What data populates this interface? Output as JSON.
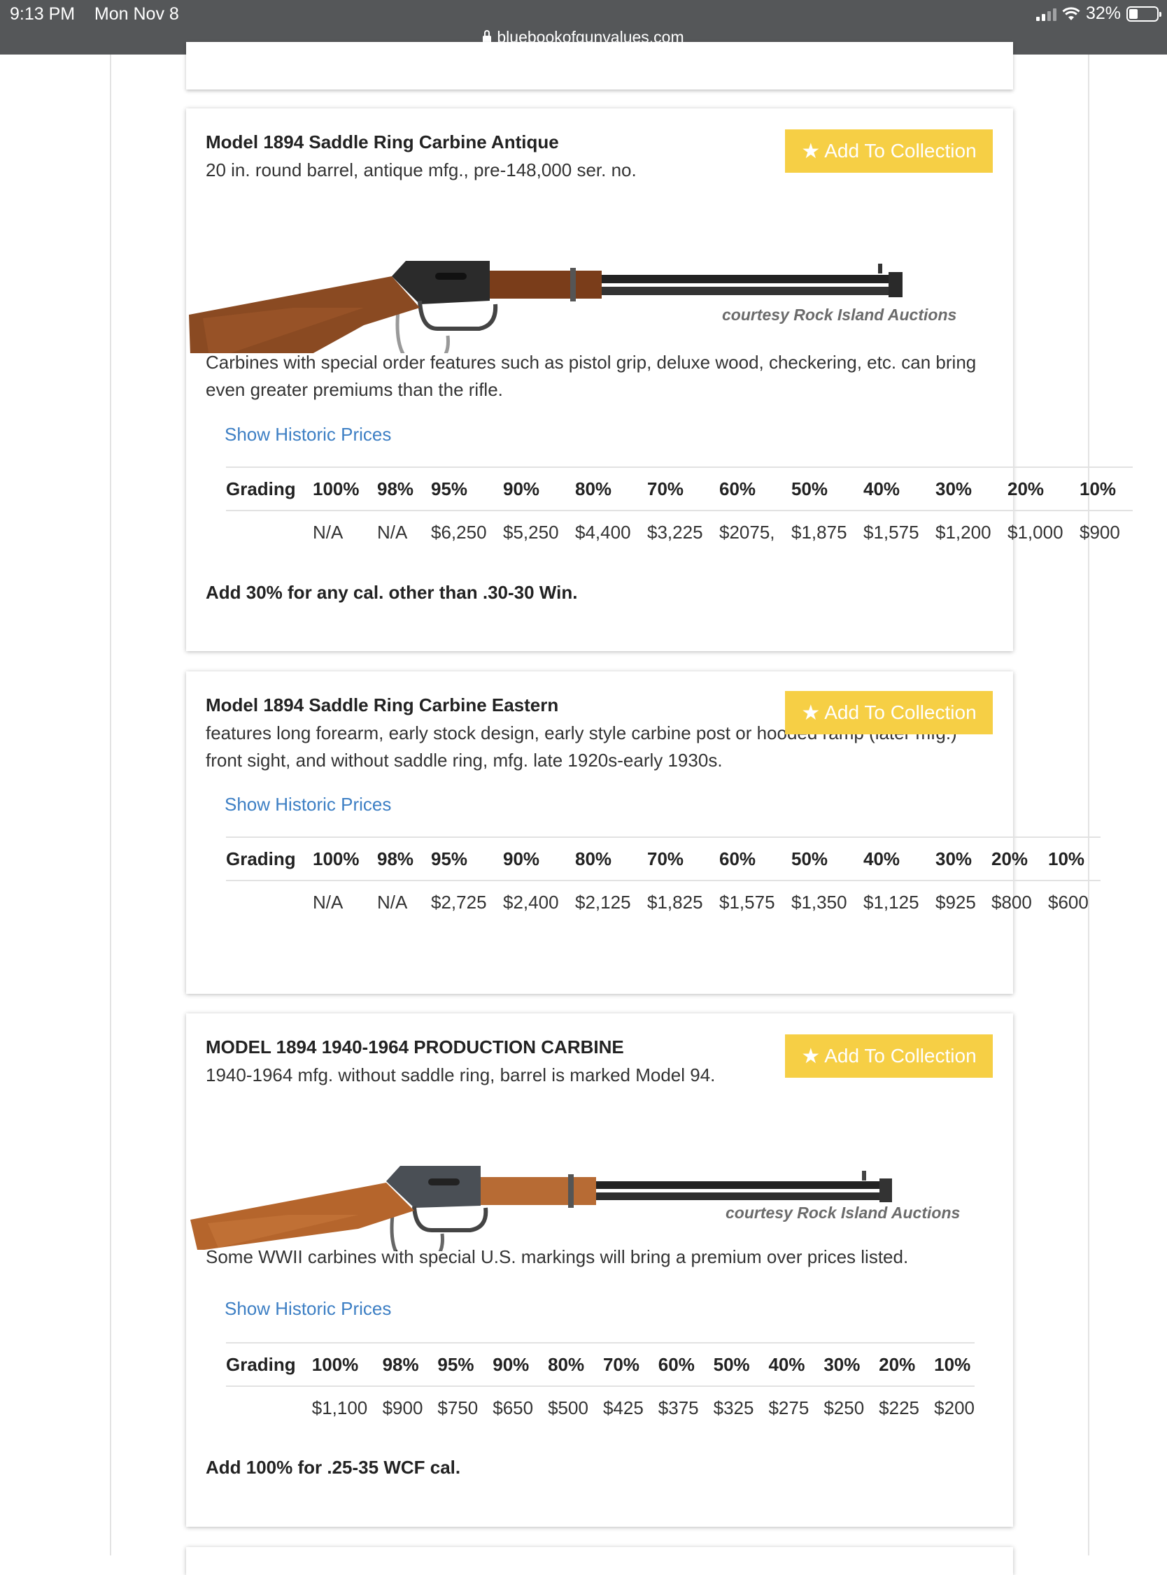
{
  "status_bar": {
    "time": "9:13 PM",
    "date": "Mon Nov 8",
    "battery": "32%",
    "battery_level": 0.32,
    "url": "bluebookofgunvalues.com"
  },
  "listings": [
    {
      "title": "Model 1894 Saddle Ring Carbine Antique",
      "description": "20 in. round barrel, antique mfg., pre-148,000 ser. no.",
      "button_label": "Add To Collection",
      "image_credit": "courtesy Rock Island Auctions",
      "note": "Carbines with special order features such as pistol grip, deluxe wood, checkering, etc. can bring even greater premiums than the rifle.",
      "history_link": "Show Historic Prices",
      "grading_label": "Grading",
      "grades": [
        "100%",
        "98%",
        "95%",
        "90%",
        "80%",
        "70%",
        "60%",
        "50%",
        "40%",
        "30%",
        "20%",
        "10%"
      ],
      "prices": [
        "N/A",
        "N/A",
        "$6,250",
        "$5,250",
        "$4,400",
        "$3,225",
        "$2075,",
        "$1,875",
        "$1,575",
        "$1,200",
        "$1,000",
        "$900"
      ],
      "footnote": "Add 30% for any cal. other than .30-30 Win."
    },
    {
      "title": "Model 1894 Saddle Ring Carbine Eastern",
      "description": "features long forearm, early stock design, early style carbine post or hooded ramp (later mfg.) front sight, and without saddle ring, mfg. late 1920s-early 1930s.",
      "button_label": "Add To Collection",
      "history_link": "Show Historic Prices",
      "grading_label": "Grading",
      "grades": [
        "100%",
        "98%",
        "95%",
        "90%",
        "80%",
        "70%",
        "60%",
        "50%",
        "40%",
        "30%",
        "20%",
        "10%"
      ],
      "prices": [
        "N/A",
        "N/A",
        "$2,725",
        "$2,400",
        "$2,125",
        "$1,825",
        "$1,575",
        "$1,350",
        "$1,125",
        "$925",
        "$800",
        "$600"
      ]
    },
    {
      "title": "MODEL 1894 1940-1964 PRODUCTION CARBINE",
      "description": "1940-1964 mfg. without saddle ring, barrel is marked Model 94.",
      "button_label": "Add To Collection",
      "image_credit": "courtesy Rock Island Auctions",
      "note": "Some WWII carbines with special U.S. markings will bring a premium over prices listed.",
      "history_link": "Show Historic Prices",
      "grading_label": "Grading",
      "grades": [
        "100%",
        "98%",
        "95%",
        "90%",
        "80%",
        "70%",
        "60%",
        "50%",
        "40%",
        "30%",
        "20%",
        "10%"
      ],
      "prices": [
        "$1,100",
        "$900",
        "$750",
        "$650",
        "$500",
        "$425",
        "$375",
        "$325",
        "$275",
        "$250",
        "$225",
        "$200"
      ],
      "footnote": "Add 100% for .25-35 WCF cal."
    }
  ]
}
